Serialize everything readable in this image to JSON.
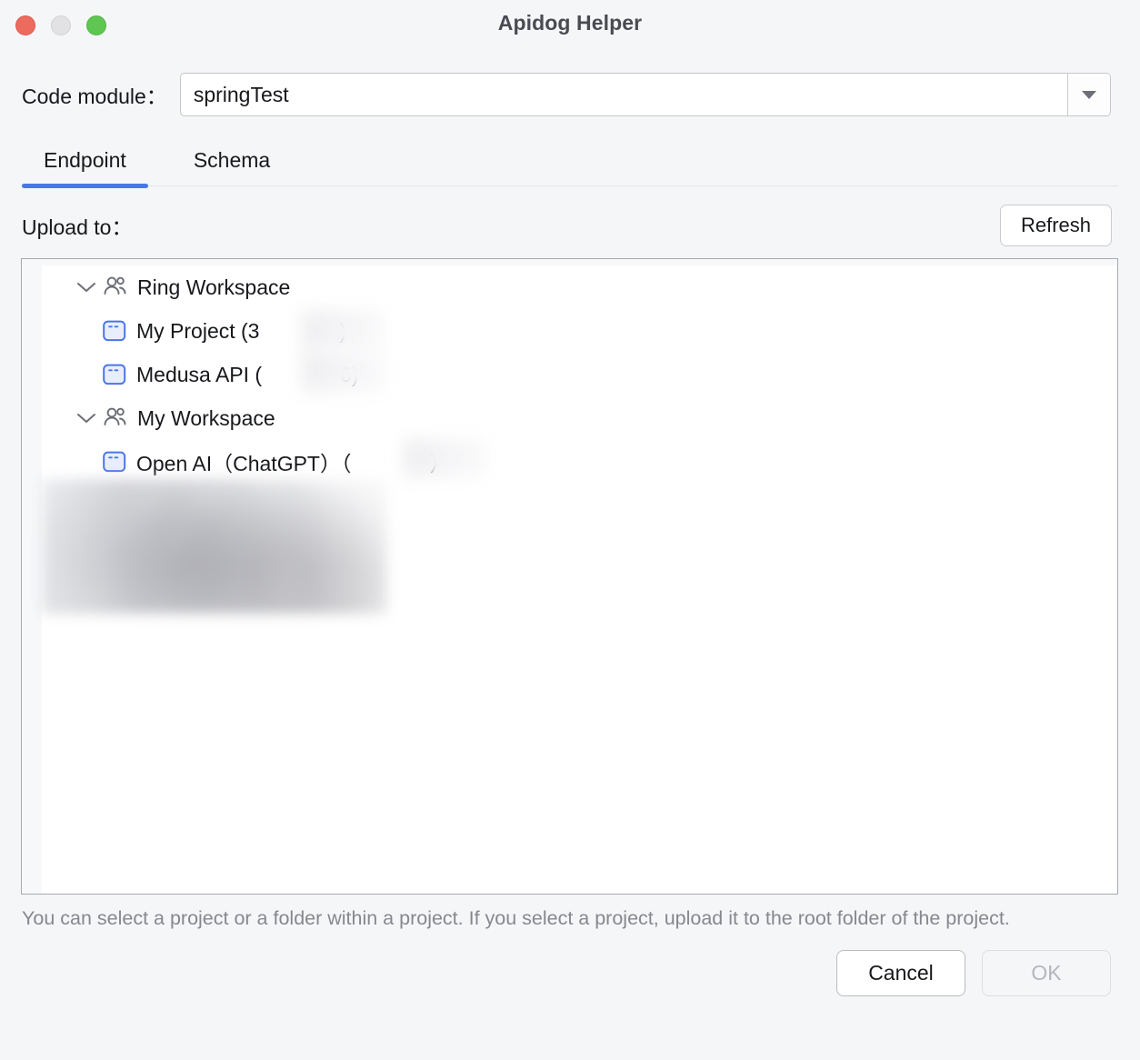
{
  "window": {
    "title": "Apidog Helper",
    "traffic_lights": [
      {
        "name": "close",
        "color": "#ec6a5e"
      },
      {
        "name": "minimize",
        "color": "#e2e2e4"
      },
      {
        "name": "zoom",
        "color": "#60c652"
      }
    ]
  },
  "module": {
    "label": "Code module：",
    "value": "springTest",
    "arrow_icon": "chevron-down-icon"
  },
  "tabs": [
    {
      "label": "Endpoint",
      "active": true
    },
    {
      "label": "Schema",
      "active": false
    }
  ],
  "upload": {
    "label": "Upload to：",
    "refresh_label": "Refresh"
  },
  "tree": [
    {
      "type": "workspace",
      "label": "Ring Workspace",
      "expanded": true,
      "chevron_icon": "chevron-down-icon",
      "icon": "workspace-people-icon",
      "children": [
        {
          "type": "project",
          "label": "My Project (3",
          "label_suffix": ")",
          "icon": "project-icon",
          "redacted": true
        },
        {
          "type": "project",
          "label": "Medusa API (",
          "label_suffix": "6)",
          "icon": "project-icon",
          "redacted": true
        }
      ]
    },
    {
      "type": "workspace",
      "label": "My Workspace",
      "expanded": true,
      "chevron_icon": "chevron-down-icon",
      "icon": "workspace-people-icon",
      "children": [
        {
          "type": "project",
          "label": "Open AI（ChatGPT）（",
          "label_suffix": "）",
          "icon": "project-icon",
          "redacted": true
        }
      ]
    }
  ],
  "hint": "You can select a project or a folder within a project. If you select a project, upload it to the root folder of the project.",
  "footer": {
    "cancel_label": "Cancel",
    "ok_label": "OK",
    "ok_disabled": true
  },
  "colors": {
    "accent": "#4a76e8",
    "window_bg": "#f5f6f8",
    "panel_bg": "#ffffff",
    "text": "#17181c",
    "muted_text": "#86888f",
    "project_icon": "#4a76e8"
  }
}
